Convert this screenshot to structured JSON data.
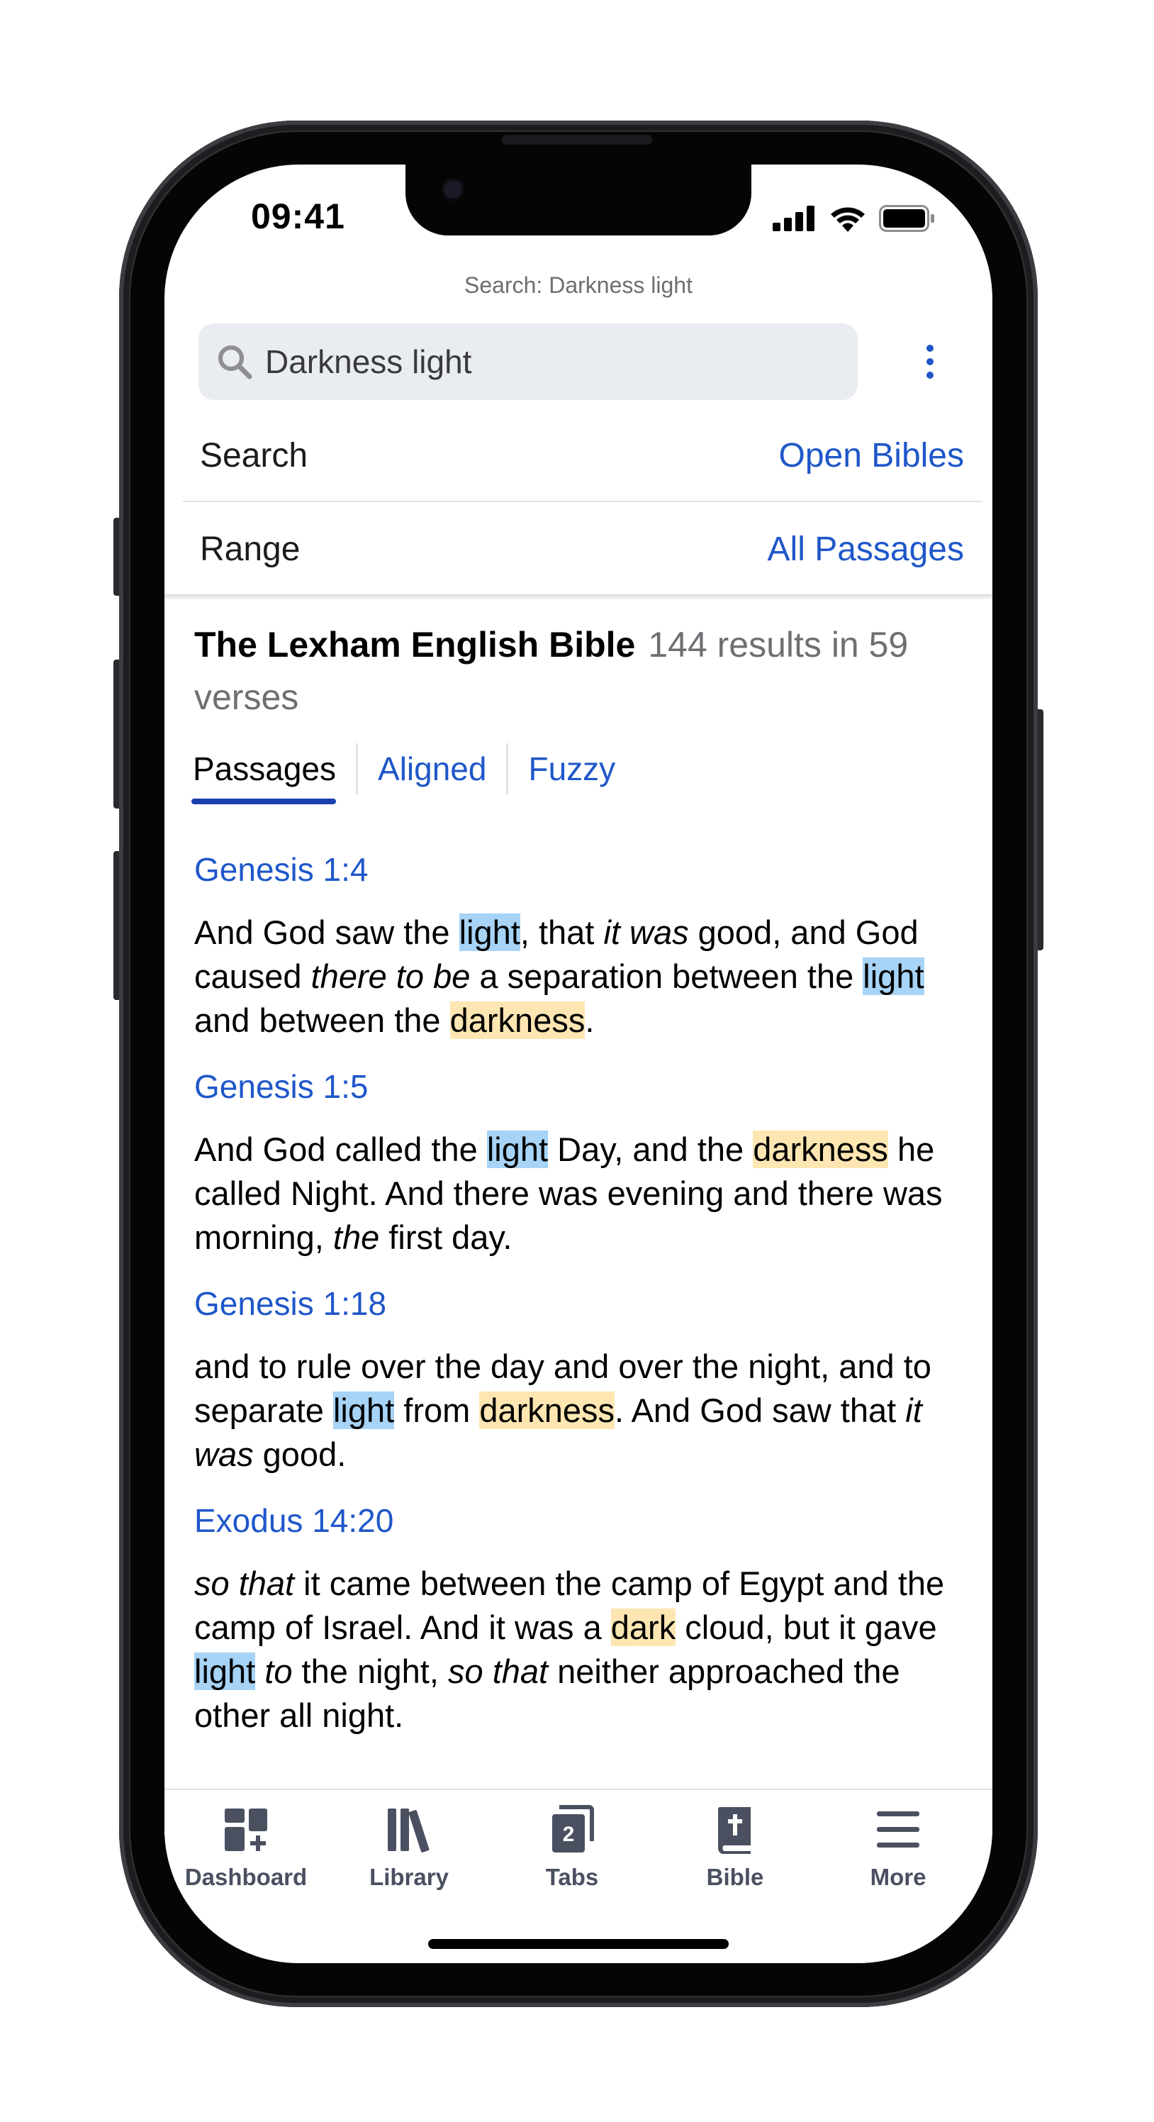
{
  "status_bar": {
    "time": "09:41"
  },
  "header": {
    "caption": "Search: Darkness light",
    "search_value": "Darkness light",
    "rows": [
      {
        "label": "Search",
        "value": "Open Bibles"
      },
      {
        "label": "Range",
        "value": "All Passages"
      }
    ]
  },
  "results": {
    "bible": "The Lexham English Bible",
    "count": "144 results in 59 verses",
    "tabs": [
      "Passages",
      "Aligned",
      "Fuzzy"
    ],
    "active_tab": "Passages",
    "items": [
      {
        "ref": "Genesis 1:4",
        "segments": [
          {
            "t": "And God saw the "
          },
          {
            "t": "light",
            "h": "b"
          },
          {
            "t": ", that "
          },
          {
            "t": "it was",
            "i": true
          },
          {
            "t": " good, and God caused "
          },
          {
            "t": "there to be",
            "i": true
          },
          {
            "t": " a separation between the "
          },
          {
            "t": "light",
            "h": "b"
          },
          {
            "t": " and between the "
          },
          {
            "t": "darkness",
            "h": "y"
          },
          {
            "t": "."
          }
        ]
      },
      {
        "ref": "Genesis 1:5",
        "segments": [
          {
            "t": "And God called the "
          },
          {
            "t": "light",
            "h": "b"
          },
          {
            "t": " Day, and the "
          },
          {
            "t": "darkness",
            "h": "y"
          },
          {
            "t": " he called Night. And there was evening and there was morning, "
          },
          {
            "t": "the",
            "i": true
          },
          {
            "t": " first day."
          }
        ]
      },
      {
        "ref": "Genesis 1:18",
        "segments": [
          {
            "t": "and to rule over the day and over the night, and to separate "
          },
          {
            "t": "light",
            "h": "b"
          },
          {
            "t": " from "
          },
          {
            "t": "darkness",
            "h": "y"
          },
          {
            "t": ". And God saw that "
          },
          {
            "t": "it was",
            "i": true
          },
          {
            "t": " good."
          }
        ]
      },
      {
        "ref": "Exodus 14:20",
        "segments": [
          {
            "t": "so that",
            "i": true
          },
          {
            "t": " it came between the camp of Egypt and the camp of Israel. And it was a "
          },
          {
            "t": "dark",
            "h": "y"
          },
          {
            "t": " cloud, but it gave "
          },
          {
            "t": "light",
            "h": "b"
          },
          {
            "t": " "
          },
          {
            "t": "to",
            "i": true
          },
          {
            "t": " the night, "
          },
          {
            "t": "so that",
            "i": true
          },
          {
            "t": " neither approached the other all night."
          }
        ]
      }
    ]
  },
  "tabbar": {
    "items": [
      {
        "label": "Dashboard",
        "icon": "dashboard-icon"
      },
      {
        "label": "Library",
        "icon": "library-icon"
      },
      {
        "label": "Tabs",
        "icon": "tabs-icon",
        "badge": "2"
      },
      {
        "label": "Bible",
        "icon": "bible-icon"
      },
      {
        "label": "More",
        "icon": "more-icon"
      }
    ]
  },
  "colors": {
    "accent": "#1f57c9",
    "highlight_light": "#a6d3f6",
    "highlight_dark": "#fde6b2"
  }
}
